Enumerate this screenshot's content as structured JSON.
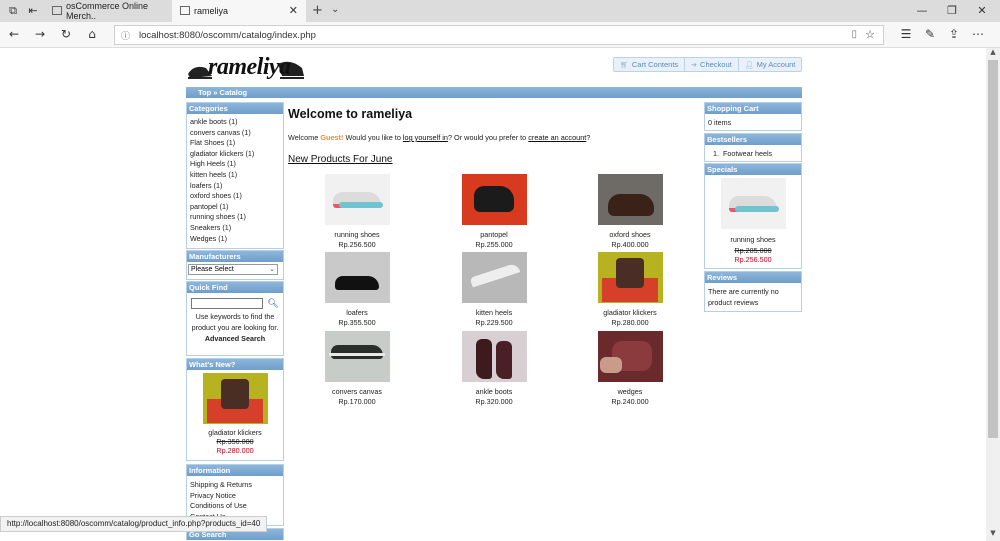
{
  "browser": {
    "tabs": [
      {
        "label": "osCommerce Online Merch.."
      },
      {
        "label": "rameliya"
      }
    ],
    "url": "localhost:8080/oscomm/catalog/index.php",
    "status_url": "http://localhost:8080/oscomm/catalog/product_info.php?products_id=40"
  },
  "header": {
    "logo_text": "rameliya",
    "links": [
      {
        "label": "Cart Contents",
        "icon": "cart-icon"
      },
      {
        "label": "Checkout",
        "icon": "checkout-icon"
      },
      {
        "label": "My Account",
        "icon": "account-icon"
      }
    ]
  },
  "breadcrumb": "Top » Catalog",
  "sidebar_left": {
    "categories_title": "Categories",
    "categories": [
      "ankle boots (1)",
      "convers canvas (1)",
      "Flat Shoes (1)",
      "gladiator klickers (1)",
      "High Heels (1)",
      "kitten heels (1)",
      "loafers (1)",
      "oxford shoes (1)",
      "pantopel (1)",
      "running shoes (1)",
      "Sneakers (1)",
      "Wedges (1)"
    ],
    "manufacturers_title": "Manufacturers",
    "manufacturers_select": "Please Select",
    "quickfind_title": "Quick Find",
    "quickfind_help": "Use keywords to find the product you are looking for.",
    "advanced_search": "Advanced Search",
    "whatsnew_title": "What's New?",
    "whatsnew_name": "gladiator klickers",
    "whatsnew_old_price": "Rp.350.000",
    "whatsnew_price": "Rp.280.000",
    "information_title": "Information",
    "information_links": [
      "Shipping & Returns",
      "Privacy Notice",
      "Conditions of Use",
      "Contact Us"
    ],
    "next_box_title": "Go Search"
  },
  "main": {
    "title": "Welcome to rameliya",
    "welcome_pre": "Welcome ",
    "welcome_guest": "Guest!",
    "welcome_mid": " Would you like to ",
    "login_link": "log yourself in",
    "welcome_mid2": "? Or would you prefer to ",
    "create_link": "create an account",
    "welcome_end": "?",
    "new_products_title": "New Products For June",
    "products": [
      {
        "name": "running shoes",
        "price": "Rp.256.500"
      },
      {
        "name": "pantopel",
        "price": "Rp.255.000"
      },
      {
        "name": "oxford shoes",
        "price": "Rp.400.000"
      },
      {
        "name": "loafers",
        "price": "Rp.355.500"
      },
      {
        "name": "kitten heels",
        "price": "Rp.229.500"
      },
      {
        "name": "gladiator klickers",
        "price": "Rp.280.000"
      },
      {
        "name": "convers canvas",
        "price": "Rp.170.000"
      },
      {
        "name": "ankle boots",
        "price": "Rp.320.000"
      },
      {
        "name": "wedges",
        "price": "Rp.240.000"
      }
    ]
  },
  "sidebar_right": {
    "cart_title": "Shopping Cart",
    "cart_items": "0 items",
    "bestsellers_title": "Bestsellers",
    "bestsellers": [
      "Footwear heels"
    ],
    "specials_title": "Specials",
    "special_name": "running shoes",
    "special_old_price": "Rp.285.000",
    "special_price": "Rp.256.500",
    "reviews_title": "Reviews",
    "reviews_text": "There are currently no product reviews"
  },
  "colors": {
    "box_header": "#7aa8d2",
    "guest": "#f08a2c",
    "special_price": "#d0001c"
  }
}
